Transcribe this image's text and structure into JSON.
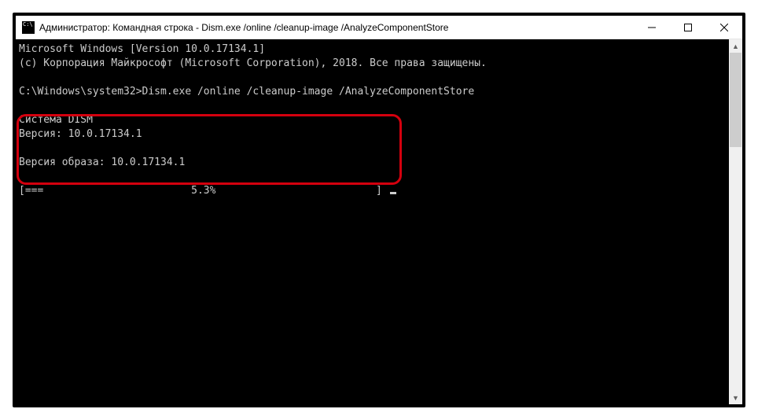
{
  "window": {
    "title": "Администратор: Командная строка - Dism.exe  /online /cleanup-image /AnalyzeComponentStore"
  },
  "terminal": {
    "line1": "Microsoft Windows [Version 10.0.17134.1]",
    "line2": "(c) Корпорация Майкрософт (Microsoft Corporation), 2018. Все права защищены.",
    "blank1": "",
    "prompt": "C:\\Windows\\system32>Dism.exe /online /cleanup-image /AnalyzeComponentStore",
    "blank2": "",
    "dism_title": "Cистема DISM",
    "dism_ver": "Версия: 10.0.17134.1",
    "blank3": "",
    "image_ver": "Версия образа: 10.0.17134.1",
    "blank4": "",
    "progress": "[===                        5.3%                          ] "
  },
  "controls": {
    "minimize": "—",
    "maximize": "☐",
    "close": "✕"
  }
}
